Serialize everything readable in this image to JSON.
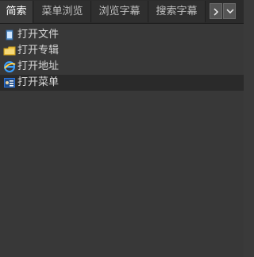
{
  "tabs": [
    {
      "label": "简索"
    },
    {
      "label": "菜单浏览"
    },
    {
      "label": "浏览字幕"
    },
    {
      "label": "搜索字幕"
    }
  ],
  "nav": {
    "next_icon": "chevron-right-icon",
    "more_icon": "chevron-down-icon"
  },
  "items": [
    {
      "label": "打开文件",
      "icon": "file-icon"
    },
    {
      "label": "打开专辑",
      "icon": "folder-icon"
    },
    {
      "label": "打开地址",
      "icon": "ie-icon"
    },
    {
      "label": "打开菜单",
      "icon": "menu-icon"
    }
  ],
  "selected_item": "打开菜单",
  "colors": {
    "background": "#383838",
    "tabbar": "#2b2b2b",
    "selected_row": "#2a2a2a",
    "text": "#d8d8d8"
  }
}
